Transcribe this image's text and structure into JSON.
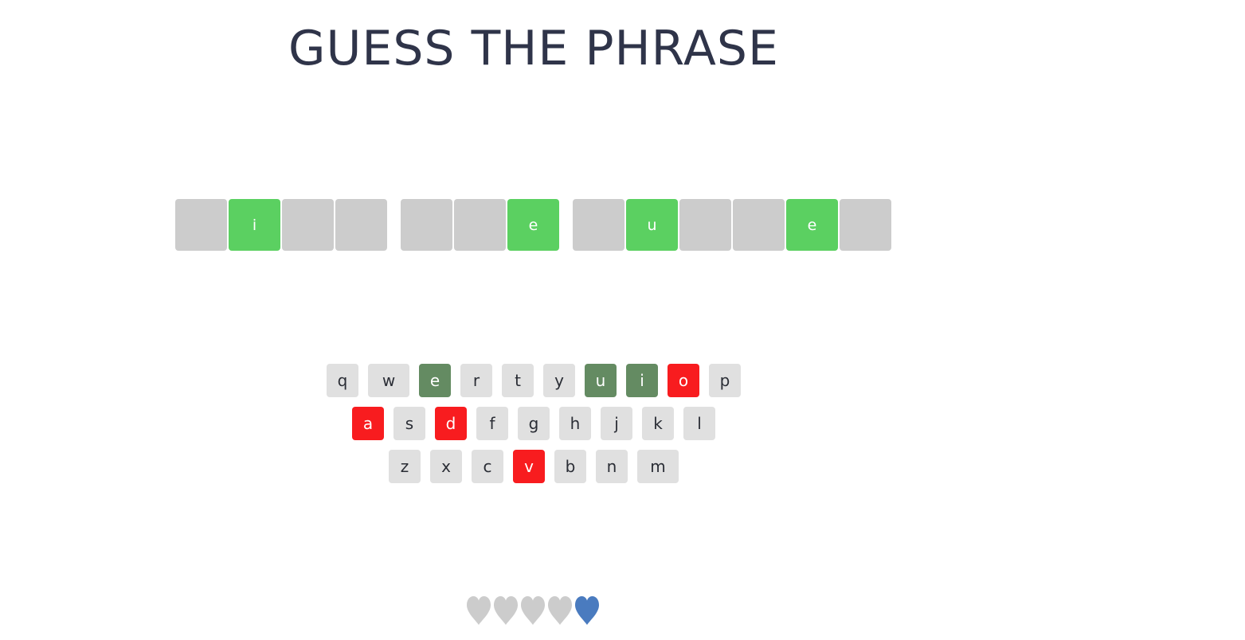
{
  "title": "GUESS THE PHRASE",
  "colors": {
    "title": "#2f3449",
    "tile_hidden": "#cccccc",
    "tile_revealed": "#5bd061",
    "key_default": "#e0e0e0",
    "key_chosen": "#648b62",
    "key_wrong": "#f81c1f",
    "heart_lost": "#cccccc",
    "heart_live": "#4a7bbf"
  },
  "phrase": {
    "words": [
      [
        {
          "letter": "",
          "revealed": false
        },
        {
          "letter": "i",
          "revealed": true
        },
        {
          "letter": "",
          "revealed": false
        },
        {
          "letter": "",
          "revealed": false
        }
      ],
      [
        {
          "letter": "",
          "revealed": false
        },
        {
          "letter": "",
          "revealed": false
        },
        {
          "letter": "e",
          "revealed": true
        }
      ],
      [
        {
          "letter": "",
          "revealed": false
        },
        {
          "letter": "u",
          "revealed": true
        },
        {
          "letter": "",
          "revealed": false
        },
        {
          "letter": "",
          "revealed": false
        },
        {
          "letter": "e",
          "revealed": true
        },
        {
          "letter": "",
          "revealed": false
        }
      ]
    ]
  },
  "keyboard": {
    "rows": [
      [
        {
          "key": "q",
          "state": "default"
        },
        {
          "key": "w",
          "state": "default"
        },
        {
          "key": "e",
          "state": "chosen"
        },
        {
          "key": "r",
          "state": "default"
        },
        {
          "key": "t",
          "state": "default"
        },
        {
          "key": "y",
          "state": "default"
        },
        {
          "key": "u",
          "state": "chosen"
        },
        {
          "key": "i",
          "state": "chosen"
        },
        {
          "key": "o",
          "state": "wrong"
        },
        {
          "key": "p",
          "state": "default"
        }
      ],
      [
        {
          "key": "a",
          "state": "wrong"
        },
        {
          "key": "s",
          "state": "default"
        },
        {
          "key": "d",
          "state": "wrong"
        },
        {
          "key": "f",
          "state": "default"
        },
        {
          "key": "g",
          "state": "default"
        },
        {
          "key": "h",
          "state": "default"
        },
        {
          "key": "j",
          "state": "default"
        },
        {
          "key": "k",
          "state": "default"
        },
        {
          "key": "l",
          "state": "default"
        }
      ],
      [
        {
          "key": "z",
          "state": "default"
        },
        {
          "key": "x",
          "state": "default"
        },
        {
          "key": "c",
          "state": "default"
        },
        {
          "key": "v",
          "state": "wrong"
        },
        {
          "key": "b",
          "state": "default"
        },
        {
          "key": "n",
          "state": "default"
        },
        {
          "key": "m",
          "state": "default"
        }
      ]
    ]
  },
  "lives": {
    "icon": "heart-icon",
    "total": 5,
    "remaining": 1
  }
}
